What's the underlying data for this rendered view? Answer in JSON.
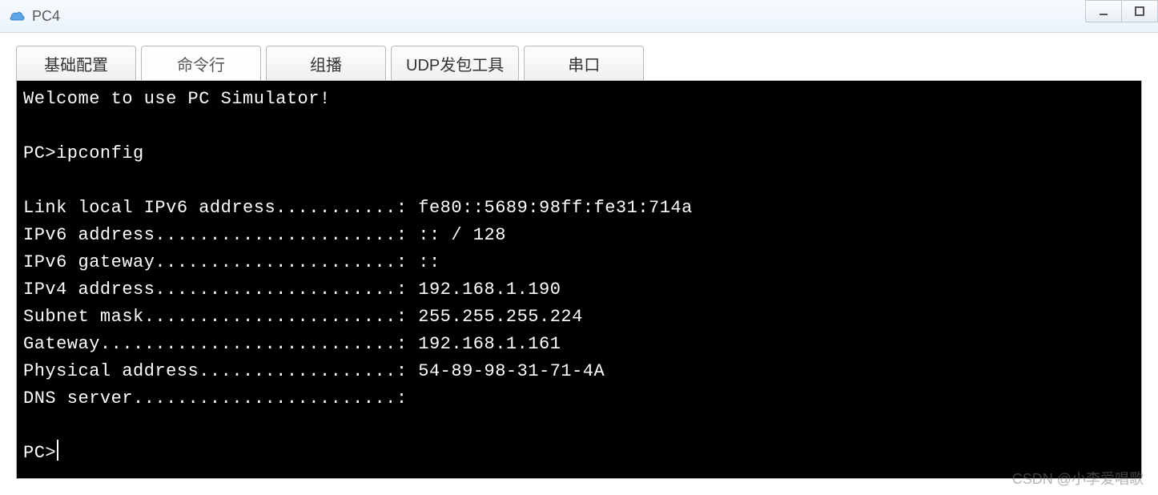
{
  "window": {
    "title": "PC4"
  },
  "tabs": {
    "items": [
      {
        "label": "基础配置"
      },
      {
        "label": "命令行"
      },
      {
        "label": "组播"
      },
      {
        "label": "UDP发包工具"
      },
      {
        "label": "串口"
      }
    ],
    "active_index": 1
  },
  "terminal": {
    "welcome": "Welcome to use PC Simulator!",
    "prompt": "PC>",
    "command": "ipconfig",
    "lines": {
      "link_local_ipv6": "Link local IPv6 address...........: fe80::5689:98ff:fe31:714a",
      "ipv6_address": "IPv6 address......................: :: / 128",
      "ipv6_gateway": "IPv6 gateway......................: ::",
      "ipv4_address": "IPv4 address......................: 192.168.1.190",
      "subnet_mask": "Subnet mask.......................: 255.255.255.224",
      "gateway": "Gateway...........................: 192.168.1.161",
      "physical_addr": "Physical address..................: 54-89-98-31-71-4A",
      "dns_server": "DNS server........................:"
    }
  },
  "watermark": "CSDN @小李爱唱歌"
}
